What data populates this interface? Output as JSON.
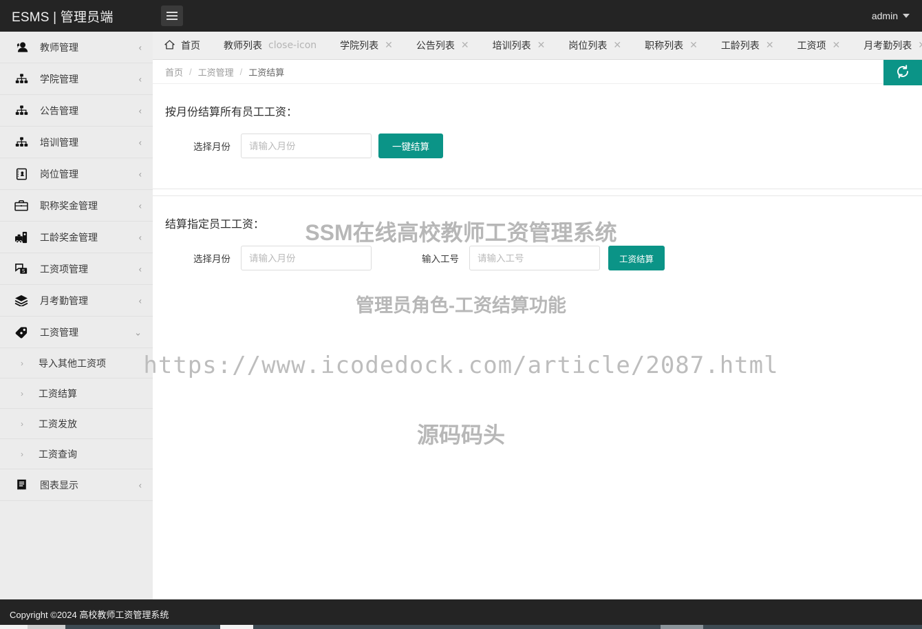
{
  "topbar": {
    "brand": "ESMS | 管理员端",
    "menu_toggle_icon": "hamburger-icon",
    "user": "admin"
  },
  "sidebar": {
    "items": [
      {
        "label": "教师管理",
        "icon": "users-icon",
        "arrow": "‹",
        "expanded": false
      },
      {
        "label": "学院管理",
        "icon": "sitemap-icon",
        "arrow": "‹",
        "expanded": false
      },
      {
        "label": "公告管理",
        "icon": "sitemap-icon",
        "arrow": "‹",
        "expanded": false
      },
      {
        "label": "培训管理",
        "icon": "sitemap-icon",
        "arrow": "‹",
        "expanded": false
      },
      {
        "label": "岗位管理",
        "icon": "id-badge-icon",
        "arrow": "‹",
        "expanded": false
      },
      {
        "label": "职称奖金管理",
        "icon": "briefcase-icon",
        "arrow": "‹",
        "expanded": false
      },
      {
        "label": "工龄奖金管理",
        "icon": "toolbox-icon",
        "arrow": "‹",
        "expanded": false
      },
      {
        "label": "工资项管理",
        "icon": "money-note-icon",
        "arrow": "‹",
        "expanded": false
      },
      {
        "label": "月考勤管理",
        "icon": "layers-icon",
        "arrow": "‹",
        "expanded": false
      },
      {
        "label": "工资管理",
        "icon": "tags-icon",
        "arrow": "⌄",
        "expanded": true
      }
    ],
    "sub_items": [
      {
        "label": "导入其他工资项",
        "arrow": "›"
      },
      {
        "label": "工资结算",
        "arrow": "›"
      },
      {
        "label": "工资发放",
        "arrow": "›"
      },
      {
        "label": "工资查询",
        "arrow": "›"
      }
    ],
    "trailing_items": [
      {
        "label": "图表显示",
        "icon": "chart-list-icon",
        "arrow": "‹"
      }
    ]
  },
  "tabs": {
    "home": {
      "label": "首页",
      "icon": "home-icon",
      "closable": false
    },
    "items": [
      {
        "label": "教师列表",
        "closable": true
      },
      {
        "label": "学院列表",
        "closable": true
      },
      {
        "label": "公告列表",
        "closable": true
      },
      {
        "label": "培训列表",
        "closable": true
      },
      {
        "label": "岗位列表",
        "closable": true
      },
      {
        "label": "职称列表",
        "closable": true
      },
      {
        "label": "工龄列表",
        "closable": true
      },
      {
        "label": "工资项",
        "closable": true
      },
      {
        "label": "月考勤列表",
        "closable": true
      }
    ],
    "dropdown_icon": "chevron-down-icon",
    "close_icon": "close-icon"
  },
  "breadcrumb": {
    "separator": "/",
    "items": [
      "首页",
      "工资管理",
      "工资结算"
    ],
    "refresh_icon": "refresh-icon"
  },
  "main": {
    "section_all": {
      "title": "按月份结算所有员工工资：",
      "month_label": "选择月份",
      "month_placeholder": "请输入月份",
      "month_value": "",
      "submit_label": "一键结算"
    },
    "section_single": {
      "title": "结算指定员工工资：",
      "month_label": "选择月份",
      "month_placeholder": "请输入月份",
      "month_value": "",
      "empno_label": "输入工号",
      "empno_placeholder": "请输入工号",
      "empno_value": "",
      "submit_label": "工资结算"
    }
  },
  "watermark": {
    "line1": "SSM在线高校教师工资管理系统",
    "line2": "管理员角色-工资结算功能",
    "line3": "https://www.icodedock.com/article/2087.html",
    "line4": "源码码头"
  },
  "footer": {
    "text": "Copyright ©2024 高校教师工资管理系统"
  },
  "colors": {
    "accent_teal": "#0b9487",
    "topbar_dark": "#242424",
    "sidebar_bg": "#ececec",
    "tabbar_bg": "#efefef",
    "watermark_gray": "#b7b7b7"
  }
}
